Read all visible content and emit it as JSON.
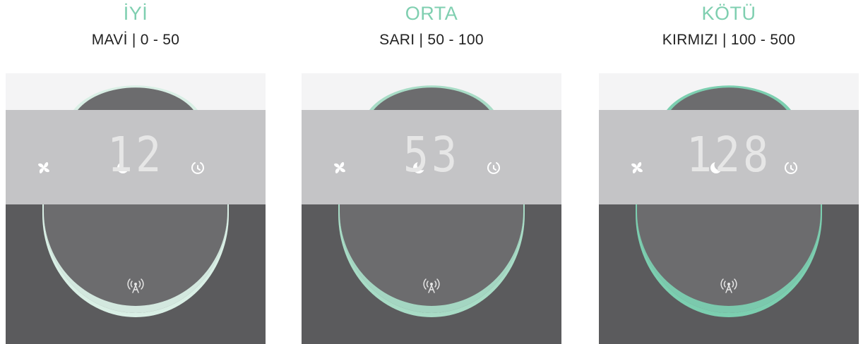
{
  "levels": [
    {
      "title": "İYİ",
      "subtitle": "MAVİ | 0 - 50",
      "reading": "12",
      "ring_color": "#d9efe5"
    },
    {
      "title": "ORTA",
      "subtitle": "SARI | 50 - 100",
      "reading": "53",
      "ring_color": "#a8dcc6"
    },
    {
      "title": "KÖTÜ",
      "subtitle": "KIRMIZI | 100 - 500",
      "reading": "128",
      "ring_color": "#7ccfb0"
    }
  ],
  "colors": {
    "title": "#7fcfb0",
    "top_band": "#f4f4f5",
    "control_band": "#c4c4c6",
    "bottom_band": "#5b5b5d",
    "dome": "#6c6c6e",
    "icon": "#ffffff"
  },
  "icons": [
    "fan-icon",
    "moon-icon",
    "timer-icon",
    "wifi-antenna-icon"
  ]
}
